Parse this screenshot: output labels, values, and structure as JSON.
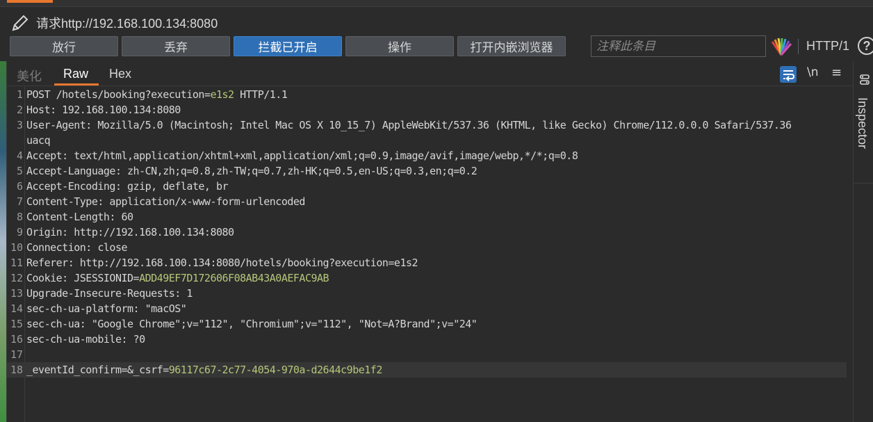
{
  "title": "请求http://192.168.100.134:8080",
  "toolbar": {
    "forward": "放行",
    "drop": "丢弃",
    "intercept": "拦截已开启",
    "action": "操作",
    "browser": "打开内嵌浏览器",
    "note_placeholder": "注释此条目",
    "protocol": "HTTP/1"
  },
  "tabs": {
    "pretty": "美化",
    "raw": "Raw",
    "hex": "Hex"
  },
  "editor_icons": {
    "newline": "\\n",
    "menu": "≡"
  },
  "inspector": {
    "label": "Inspector"
  },
  "request_lines": [
    {
      "n": "1",
      "parts": [
        {
          "t": "POST /hotels/booking?execution=",
          "c": "key"
        },
        {
          "t": "e1s2",
          "c": "green"
        },
        {
          "t": " HTTP/1.1",
          "c": "key"
        }
      ]
    },
    {
      "n": "2",
      "parts": [
        {
          "t": "Host: 192.168.100.134:8080",
          "c": "key"
        }
      ]
    },
    {
      "n": "3",
      "parts": [
        {
          "t": "User-Agent: Mozilla/5.0 (Macintosh; Intel Mac OS X 10_15_7) AppleWebKit/537.36 (KHTML, like Gecko) Chrome/112.0.0.0 Safari/537.36",
          "c": "key"
        }
      ]
    },
    {
      "n": "",
      "parts": [
        {
          "t": "uacq",
          "c": "key"
        }
      ]
    },
    {
      "n": "4",
      "parts": [
        {
          "t": "Accept: text/html,application/xhtml+xml,application/xml;q=0.9,image/avif,image/webp,*/*;q=0.8",
          "c": "key"
        }
      ]
    },
    {
      "n": "5",
      "parts": [
        {
          "t": "Accept-Language: zh-CN,zh;q=0.8,zh-TW;q=0.7,zh-HK;q=0.5,en-US;q=0.3,en;q=0.2",
          "c": "key"
        }
      ]
    },
    {
      "n": "6",
      "parts": [
        {
          "t": "Accept-Encoding: gzip, deflate, br",
          "c": "key"
        }
      ]
    },
    {
      "n": "7",
      "parts": [
        {
          "t": "Content-Type: application/x-www-form-urlencoded",
          "c": "key"
        }
      ]
    },
    {
      "n": "8",
      "parts": [
        {
          "t": "Content-Length: 60",
          "c": "key"
        }
      ]
    },
    {
      "n": "9",
      "parts": [
        {
          "t": "Origin: http://192.168.100.134:8080",
          "c": "key"
        }
      ]
    },
    {
      "n": "10",
      "parts": [
        {
          "t": "Connection: close",
          "c": "key"
        }
      ]
    },
    {
      "n": "11",
      "parts": [
        {
          "t": "Referer: http://192.168.100.134:8080/hotels/booking?execution=e1s2",
          "c": "key"
        }
      ]
    },
    {
      "n": "12",
      "parts": [
        {
          "t": "Cookie: JSESSIONID=",
          "c": "key"
        },
        {
          "t": "ADD49EF7D172606F08AB43A0AEFAC9AB",
          "c": "green"
        }
      ]
    },
    {
      "n": "13",
      "parts": [
        {
          "t": "Upgrade-Insecure-Requests: 1",
          "c": "key"
        }
      ]
    },
    {
      "n": "14",
      "parts": [
        {
          "t": "sec-ch-ua-platform: \"macOS\"",
          "c": "key"
        }
      ]
    },
    {
      "n": "15",
      "parts": [
        {
          "t": "sec-ch-ua: \"Google Chrome\";v=\"112\", \"Chromium\";v=\"112\", \"Not=A?Brand\";v=\"24\"",
          "c": "key"
        }
      ]
    },
    {
      "n": "16",
      "parts": [
        {
          "t": "sec-ch-ua-mobile: ?0",
          "c": "key"
        }
      ]
    },
    {
      "n": "17",
      "parts": []
    },
    {
      "n": "18",
      "parts": [
        {
          "t": "_eventId_confirm=&_csrf=",
          "c": "key"
        },
        {
          "t": "96117c67-2c77-4054-970a-d2644c9be1f2",
          "c": "green"
        }
      ],
      "highlight": true
    }
  ]
}
